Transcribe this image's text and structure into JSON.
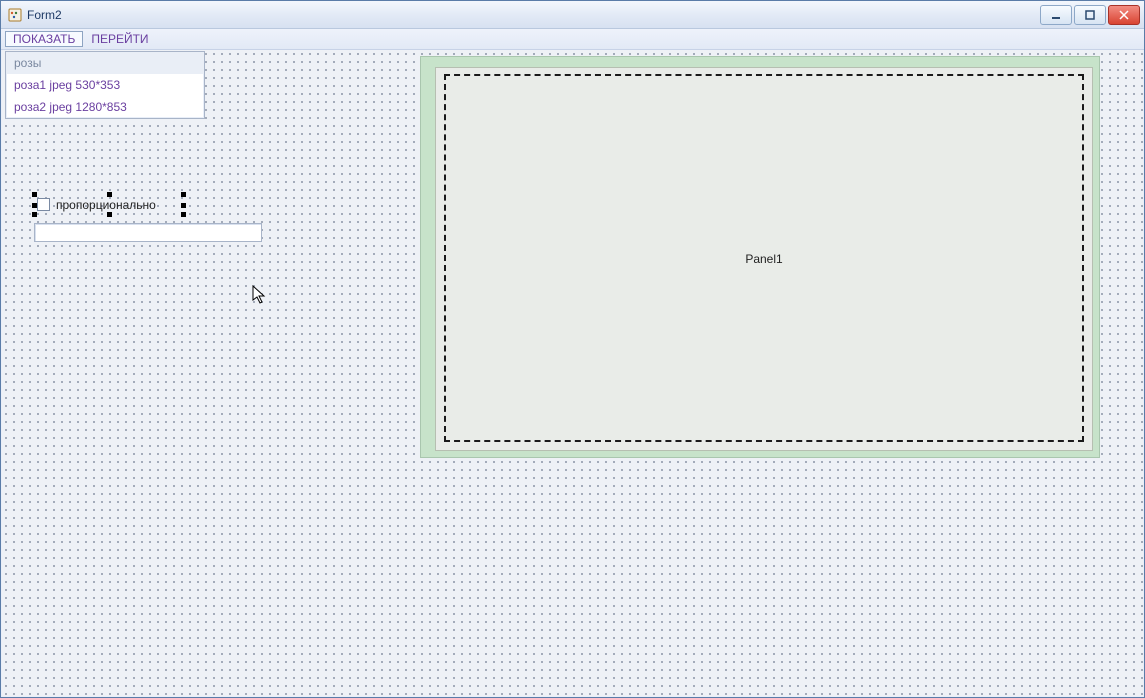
{
  "window": {
    "title": "Form2"
  },
  "menu": {
    "show": "ПОКАЗАТЬ",
    "go": "ПЕРЕЙТИ"
  },
  "listbox": {
    "items": [
      {
        "label": "розы",
        "header": true
      },
      {
        "label": "роза1 jpeg 530*353",
        "header": false
      },
      {
        "label": "роза2 jpeg 1280*853",
        "header": false
      }
    ]
  },
  "checkbox": {
    "label": "пропорционально",
    "checked": false
  },
  "edit": {
    "value": ""
  },
  "panel": {
    "caption": "Panel1"
  }
}
